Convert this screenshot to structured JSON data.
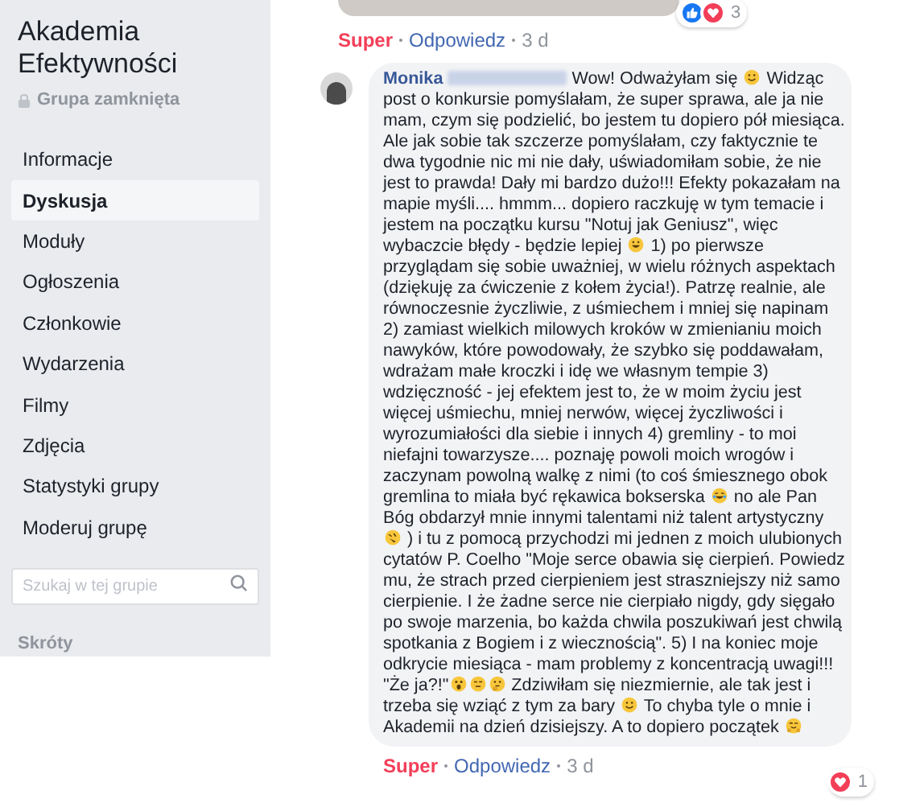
{
  "group": {
    "title": "Akademia Efektywności",
    "privacy": "Grupa zamknięta"
  },
  "nav": [
    {
      "label": "Informacje",
      "selected": false
    },
    {
      "label": "Dyskusja",
      "selected": true
    },
    {
      "label": "Moduły",
      "selected": false
    },
    {
      "label": "Ogłoszenia",
      "selected": false
    },
    {
      "label": "Członkowie",
      "selected": false
    },
    {
      "label": "Wydarzenia",
      "selected": false
    },
    {
      "label": "Filmy",
      "selected": false
    },
    {
      "label": "Zdjęcia",
      "selected": false
    },
    {
      "label": "Statystyki grupy",
      "selected": false
    },
    {
      "label": "Moderuj grupę",
      "selected": false
    }
  ],
  "search": {
    "placeholder": "Szukaj w tej grupie"
  },
  "shortcuts_heading": "Skróty",
  "previous_comment": {
    "reactions": [
      {
        "kind": "like"
      },
      {
        "kind": "love"
      }
    ],
    "reaction_count": "3",
    "actions": [
      {
        "label": "Super",
        "kind": "reaction"
      },
      {
        "label": "Odpowiedz",
        "kind": "link"
      },
      {
        "label": "3 d",
        "kind": "time"
      }
    ]
  },
  "comment": {
    "author": "Monika",
    "parts": [
      {
        "kind": "text",
        "text": "Wow! Odważyłam się "
      },
      {
        "kind": "smile"
      },
      {
        "kind": "text",
        "text": " Widząc post o konkursie pomyślałam, że super sprawa, ale ja nie mam, czym się podzielić, bo jestem tu dopiero pół miesiąca. Ale jak sobie tak szczerze pomyślałam, czy faktycznie te dwa tygodnie nic mi nie dały, uświadomiłam sobie, że nie jest to prawda! Dały mi bardzo dużo!!! Efekty pokazałam na mapie myśli.... hmmm... dopiero raczkuję w tym temacie i jestem na początku kursu \"Notuj jak Geniusz\", więc wybaczcie błędy - będzie lepiej "
      },
      {
        "kind": "grin"
      },
      {
        "kind": "text",
        "text": " 1) po pierwsze przyglądam się sobie uważniej, w wielu różnych aspektach (dziękuję za ćwiczenie z kołem życia!). Patrzę realnie, ale równoczesnie życzliwie, z uśmiechem i mniej się napinam 2) zamiast wielkich milowych kroków w zmienianiu moich nawyków, które powodowały, że szybko się poddawałam, wdrażam małe kroczki i idę we własnym tempie 3) wdzięczność - jej efektem jest to, że w moim życiu jest więcej uśmiechu, mniej nerwów, więcej życzliwości i wyrozumiałości dla siebie i innych 4) gremliny - to moi niefajni towarzysze.... poznaję powoli moich wrogów i zaczynam powolną walkę z nimi (to coś śmiesznego obok gremlina to miała być rękawica bokserska "
      },
      {
        "kind": "laugh"
      },
      {
        "kind": "text",
        "text": " no ale Pan Bóg obdarzył mnie innymi talentami niż talent artystyczny "
      },
      {
        "kind": "rofl"
      },
      {
        "kind": "text",
        "text": " ) i tu z pomocą przychodzi mi jednen z moich ulubionych cytatów P. Coelho \"Moje serce obawia się cierpień. Powiedz mu, że strach przed cierpieniem jest straszniejszy niż samo cierpienie. I że żadne serce nie cierpiało nigdy, gdy sięgało po swoje marzenia, bo każda chwila poszukiwań jest chwilą spotkania z Bogiem i z wiecznością\". 5) I na koniec moje odkrycie miesiąca - mam problemy z koncentracją uwagi!!! \"Że ja?!\""
      },
      {
        "kind": "wow"
      },
      {
        "kind": "squint"
      },
      {
        "kind": "think"
      },
      {
        "kind": "text",
        "text": " Zdziwiłam się niezmiernie, ale tak jest i trzeba się wziąć z tym za bary "
      },
      {
        "kind": "smile"
      },
      {
        "kind": "text",
        "text": " To chyba tyle o mnie i Akademii na dzień dzisiejszy. A to dopiero początek "
      },
      {
        "kind": "hug"
      }
    ],
    "reactions": [
      {
        "kind": "love"
      }
    ],
    "reaction_count": "1",
    "actions": [
      {
        "label": "Super",
        "kind": "reaction"
      },
      {
        "label": "Odpowiedz",
        "kind": "link"
      },
      {
        "label": "3 d",
        "kind": "time"
      }
    ]
  }
}
